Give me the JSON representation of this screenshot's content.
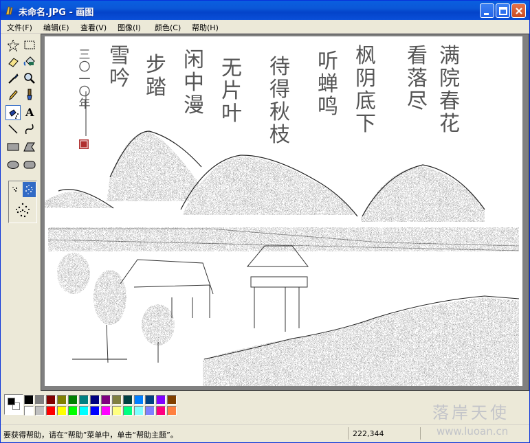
{
  "window": {
    "title": "未命名.JPG - 画图",
    "controls": {
      "minimize": "minimize",
      "maximize": "maximize",
      "close": "close"
    }
  },
  "menu": [
    {
      "label": "文件(F)"
    },
    {
      "label": "编辑(E)"
    },
    {
      "label": "查看(V)"
    },
    {
      "label": "图像(I)"
    },
    {
      "label": "颜色(C)"
    },
    {
      "label": "帮助(H)"
    }
  ],
  "tools": [
    {
      "name": "free-select",
      "icon": "star-select-icon"
    },
    {
      "name": "rect-select",
      "icon": "rect-select-icon"
    },
    {
      "name": "eraser",
      "icon": "eraser-icon"
    },
    {
      "name": "fill",
      "icon": "paint-bucket-icon"
    },
    {
      "name": "pick-color",
      "icon": "eyedropper-icon"
    },
    {
      "name": "magnifier",
      "icon": "magnifier-icon"
    },
    {
      "name": "pencil",
      "icon": "pencil-icon"
    },
    {
      "name": "brush",
      "icon": "brush-icon"
    },
    {
      "name": "airbrush",
      "icon": "airbrush-icon",
      "active": true
    },
    {
      "name": "text",
      "icon": "text-icon"
    },
    {
      "name": "line",
      "icon": "line-icon"
    },
    {
      "name": "curve",
      "icon": "curve-icon"
    },
    {
      "name": "rectangle",
      "icon": "rectangle-icon"
    },
    {
      "name": "polygon",
      "icon": "polygon-icon"
    },
    {
      "name": "ellipse",
      "icon": "ellipse-icon"
    },
    {
      "name": "rounded-rect",
      "icon": "rounded-rect-icon"
    }
  ],
  "text_tool_glyph": "A",
  "palette": {
    "foreground": "#000000",
    "background": "#ffffff",
    "row1": [
      "#000000",
      "#808080",
      "#800000",
      "#808000",
      "#008000",
      "#008080",
      "#000080",
      "#800080",
      "#808040",
      "#004040",
      "#0080ff",
      "#004080",
      "#8000ff",
      "#804000"
    ],
    "row2": [
      "#ffffff",
      "#c0c0c0",
      "#ff0000",
      "#ffff00",
      "#00ff00",
      "#00ffff",
      "#0000ff",
      "#ff00ff",
      "#ffff80",
      "#00ff80",
      "#80ffff",
      "#8080ff",
      "#ff0080",
      "#ff8040"
    ]
  },
  "canvas": {
    "poem_columns": [
      "满院春花",
      "看落尽",
      "枫阴底下",
      "听蝉鸣",
      "待得秋枝",
      "无片叶",
      "闲中漫",
      "步踏",
      "雪吟",
      "三〇一〇年"
    ]
  },
  "status": {
    "help_text": "要获得帮助，请在“帮助”菜单中，单击“帮助主题”。",
    "coords": "222,344"
  },
  "watermark": {
    "text": "落岸天使",
    "url": "www.luoan.cn"
  }
}
